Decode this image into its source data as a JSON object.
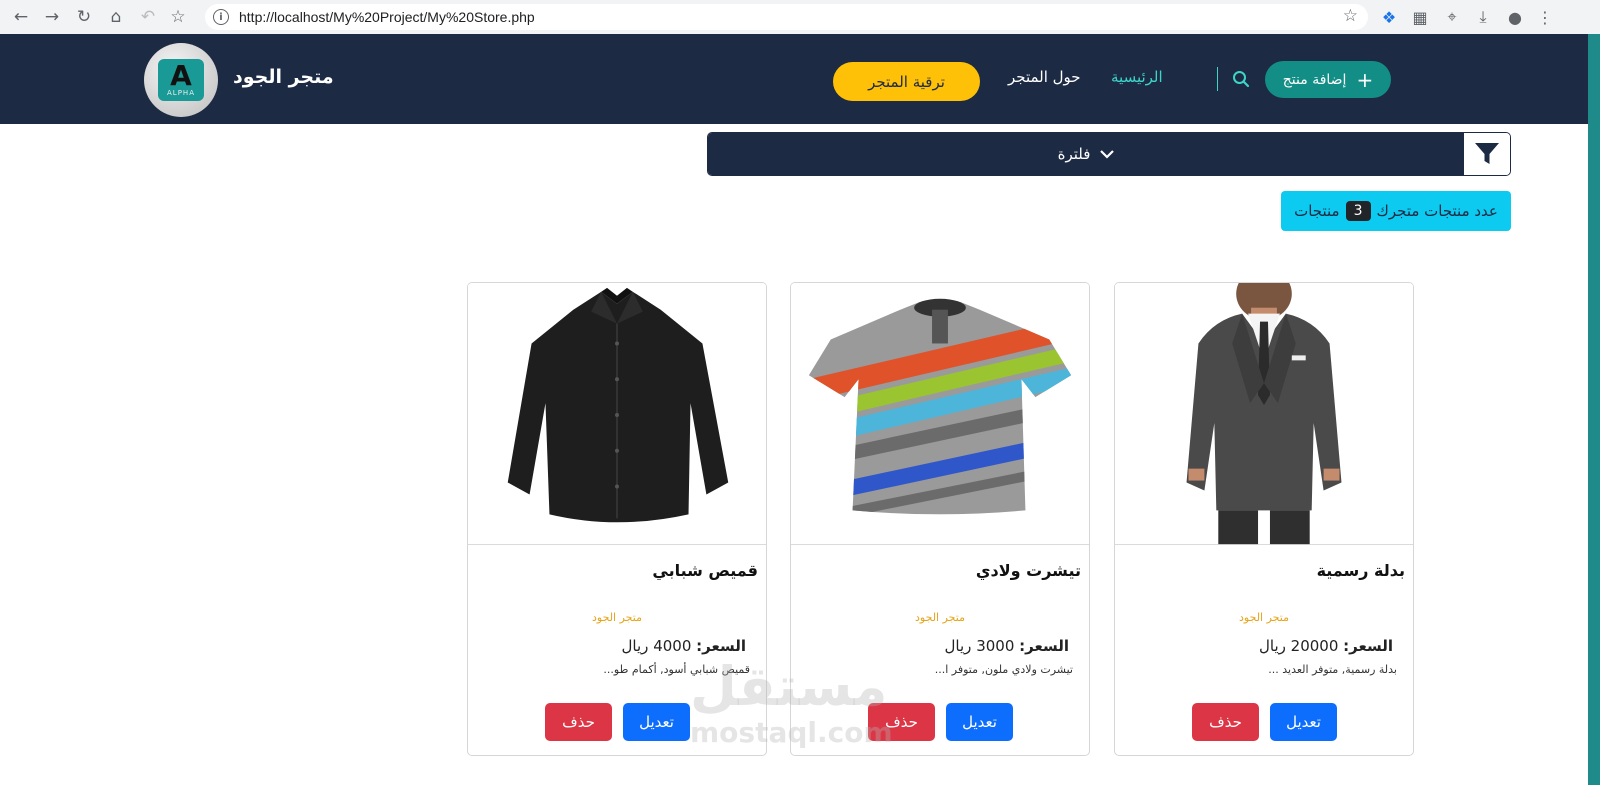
{
  "browser": {
    "url": "http://localhost/My%20Project/My%20Store.php"
  },
  "navbar": {
    "brand": "متجر الجود",
    "logo_text": "A",
    "logo_sub": "ALPHA",
    "upgrade_label": "ترقية المتجر",
    "about_label": "حول المتجر",
    "home_label": "الرئيسية",
    "add_product_label": "إضافة منتج",
    "accent": "#3dd5c8",
    "bg": "#1d2a44"
  },
  "filter": {
    "label": "فلترة"
  },
  "count": {
    "prefix": "عدد منتجات متجرك",
    "value": "3",
    "suffix": "منتجات"
  },
  "products": [
    {
      "title": "بدلة رسمية",
      "store": "متجر الجود",
      "price_label": "السعر:",
      "price_value": "20000 ريال",
      "desc": "بدلة رسمية, متوفر العديد ...",
      "edit_label": "تعديل",
      "delete_label": "حذف",
      "image": "suit-image"
    },
    {
      "title": "تيشرت ولادي",
      "store": "متجر الجود",
      "price_label": "السعر:",
      "price_value": "3000 ريال",
      "desc": "تيشرت ولادي ملون, متوفر ا...",
      "edit_label": "تعديل",
      "delete_label": "حذف",
      "image": "kids-tshirt-image"
    },
    {
      "title": "قميص شبابي",
      "store": "متجر الجود",
      "price_label": "السعر:",
      "price_value": "4000 ريال",
      "desc": "قميص شبابي أسود, أكمام طو...",
      "edit_label": "تعديل",
      "delete_label": "حذف",
      "image": "black-shirt-image"
    }
  ],
  "watermark": {
    "arabic": "مستقل",
    "latin": "mostaql.com"
  }
}
